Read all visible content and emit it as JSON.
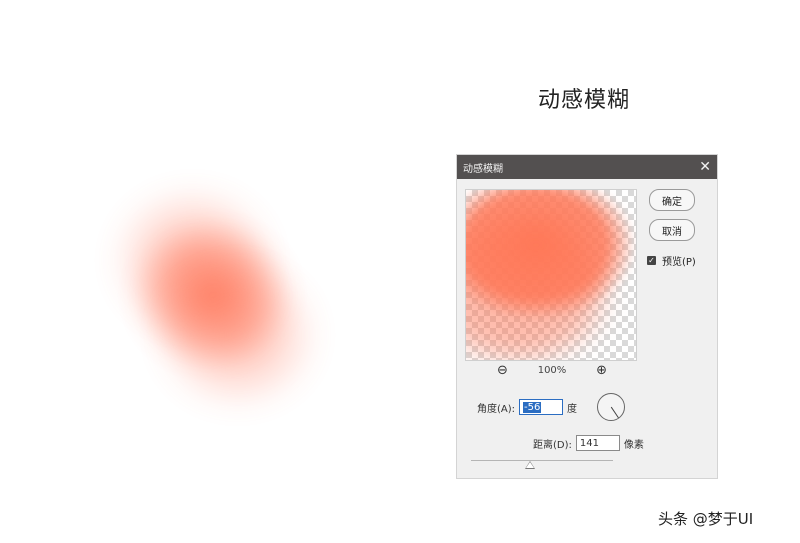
{
  "page": {
    "title": "动感模糊",
    "watermark": "头条 @梦于UI"
  },
  "dialog": {
    "title": "动感模糊",
    "buttons": {
      "ok": "确定",
      "cancel": "取消"
    },
    "preview_checkbox": {
      "label": "预览(P)",
      "checked": true
    },
    "zoom": {
      "level": "100%"
    },
    "angle": {
      "label": "角度(A):",
      "value": "-56",
      "unit": "度"
    },
    "distance": {
      "label": "距离(D):",
      "value": "141",
      "unit": "像素"
    }
  },
  "colors": {
    "accent": "#ff7052",
    "titlebar": "#535050",
    "focus": "#2b6dc2"
  },
  "icons": [
    "close-icon",
    "zoom-out-icon",
    "zoom-in-icon",
    "checkbox-checked-icon",
    "angle-dial-icon",
    "slider-thumb-icon"
  ]
}
